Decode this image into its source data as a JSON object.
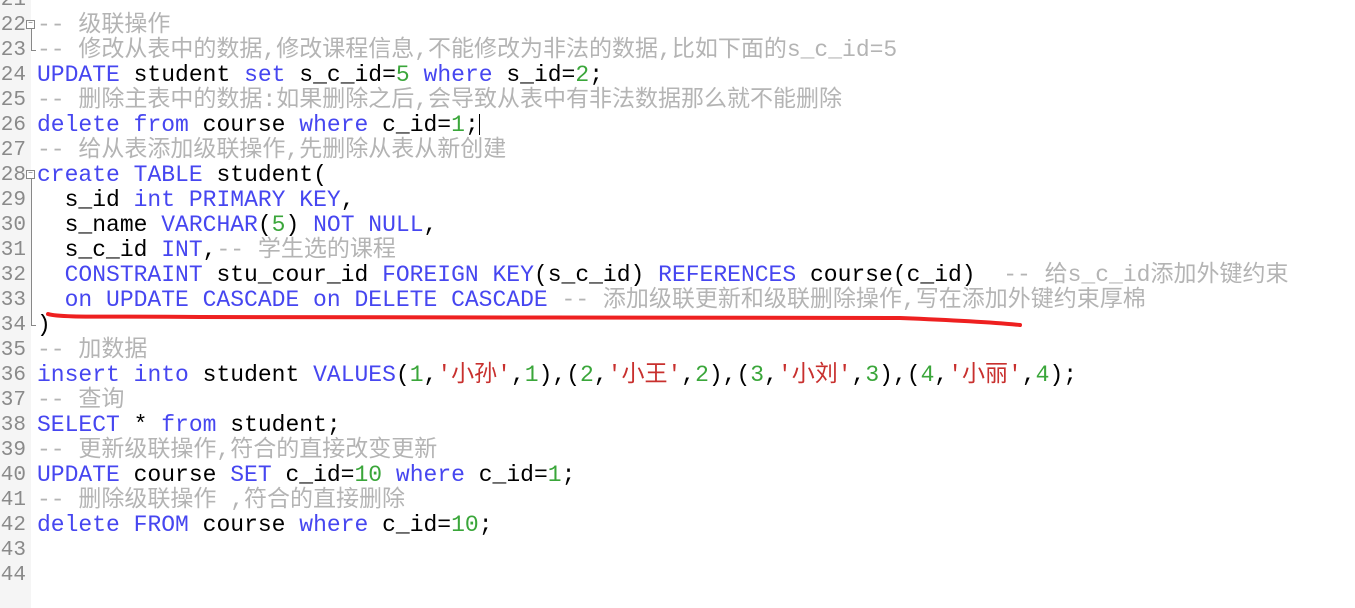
{
  "editor": {
    "colors": {
      "keyword": "#4646f0",
      "identifier": "#000000",
      "number": "#3aa63a",
      "string": "#c8302e",
      "comment": "#b4b4b4",
      "annotation": "#ee2020"
    },
    "lines": [
      {
        "n": "21",
        "t": []
      },
      {
        "n": "22",
        "fold": "open",
        "t": [
          [
            "cm",
            "-- 级联操作"
          ]
        ]
      },
      {
        "n": "23",
        "fold": "end",
        "t": [
          [
            "cm",
            "-- 修改从表中的数据,修改课程信息,不能修改为非法的数据,比如下面的s_c_id=5"
          ]
        ]
      },
      {
        "n": "24",
        "t": [
          [
            "kw",
            "UPDATE"
          ],
          [
            "id",
            " student "
          ],
          [
            "kw",
            "set"
          ],
          [
            "id",
            " s_c_id="
          ],
          [
            "num",
            "5"
          ],
          [
            "id",
            " "
          ],
          [
            "kw",
            "where"
          ],
          [
            "id",
            " s_id="
          ],
          [
            "num",
            "2"
          ],
          [
            "id",
            ";"
          ]
        ]
      },
      {
        "n": "25",
        "t": [
          [
            "cm",
            "-- 删除主表中的数据:如果删除之后,会导致从表中有非法数据那么就不能删除"
          ]
        ]
      },
      {
        "n": "26",
        "caret": true,
        "t": [
          [
            "kw",
            "delete"
          ],
          [
            "id",
            " "
          ],
          [
            "kw",
            "from"
          ],
          [
            "id",
            " course "
          ],
          [
            "kw",
            "where"
          ],
          [
            "id",
            " c_id="
          ],
          [
            "num",
            "1"
          ],
          [
            "id",
            ";"
          ]
        ]
      },
      {
        "n": "27",
        "t": [
          [
            "cm",
            "-- 给从表添加级联操作,先删除从表从新创建"
          ]
        ]
      },
      {
        "n": "28",
        "fold": "open",
        "t": [
          [
            "kw",
            "create"
          ],
          [
            "id",
            " "
          ],
          [
            "kw",
            "TABLE"
          ],
          [
            "id",
            " student("
          ]
        ]
      },
      {
        "n": "29",
        "t": [
          [
            "id",
            "  s_id "
          ],
          [
            "kw",
            "int"
          ],
          [
            "id",
            " "
          ],
          [
            "kw",
            "PRIMARY KEY"
          ],
          [
            "id",
            ","
          ]
        ]
      },
      {
        "n": "30",
        "t": [
          [
            "id",
            "  s_name "
          ],
          [
            "kw",
            "VARCHAR"
          ],
          [
            "id",
            "("
          ],
          [
            "num",
            "5"
          ],
          [
            "id",
            ") "
          ],
          [
            "kw",
            "NOT NULL"
          ],
          [
            "id",
            ","
          ]
        ]
      },
      {
        "n": "31",
        "t": [
          [
            "id",
            "  s_c_id "
          ],
          [
            "kw",
            "INT"
          ],
          [
            "id",
            ","
          ],
          [
            "cm",
            "-- 学生选的课程"
          ]
        ]
      },
      {
        "n": "32",
        "t": [
          [
            "id",
            "  "
          ],
          [
            "kw",
            "CONSTRAINT"
          ],
          [
            "id",
            " stu_cour_id "
          ],
          [
            "kw",
            "FOREIGN KEY"
          ],
          [
            "id",
            "(s_c_id) "
          ],
          [
            "kw",
            "REFERENCES"
          ],
          [
            "id",
            " course(c_id)  "
          ],
          [
            "cm",
            "-- 给s_c_id添加外键约束"
          ]
        ]
      },
      {
        "n": "33",
        "t": [
          [
            "id",
            "  "
          ],
          [
            "kw",
            "on UPDATE CASCADE on DELETE CASCADE"
          ],
          [
            "id",
            " "
          ],
          [
            "cm",
            "-- 添加级联更新和级联删除操作,写在添加外键约束厚棉"
          ]
        ]
      },
      {
        "n": "34",
        "fold": "end",
        "t": [
          [
            "id",
            ")"
          ]
        ]
      },
      {
        "n": "35",
        "t": [
          [
            "cm",
            "-- 加数据"
          ]
        ]
      },
      {
        "n": "36",
        "t": [
          [
            "kw",
            "insert"
          ],
          [
            "id",
            " "
          ],
          [
            "kw",
            "into"
          ],
          [
            "id",
            " student "
          ],
          [
            "kw",
            "VALUES"
          ],
          [
            "id",
            "("
          ],
          [
            "num",
            "1"
          ],
          [
            "id",
            ","
          ],
          [
            "str",
            "'小孙'"
          ],
          [
            "id",
            ","
          ],
          [
            "num",
            "1"
          ],
          [
            "id",
            "),("
          ],
          [
            "num",
            "2"
          ],
          [
            "id",
            ","
          ],
          [
            "str",
            "'小王'"
          ],
          [
            "id",
            ","
          ],
          [
            "num",
            "2"
          ],
          [
            "id",
            "),("
          ],
          [
            "num",
            "3"
          ],
          [
            "id",
            ","
          ],
          [
            "str",
            "'小刘'"
          ],
          [
            "id",
            ","
          ],
          [
            "num",
            "3"
          ],
          [
            "id",
            "),("
          ],
          [
            "num",
            "4"
          ],
          [
            "id",
            ","
          ],
          [
            "str",
            "'小丽'"
          ],
          [
            "id",
            ","
          ],
          [
            "num",
            "4"
          ],
          [
            "id",
            ");"
          ]
        ]
      },
      {
        "n": "37",
        "t": [
          [
            "cm",
            "-- 查询"
          ]
        ]
      },
      {
        "n": "38",
        "t": [
          [
            "kw",
            "SELECT"
          ],
          [
            "id",
            " * "
          ],
          [
            "kw",
            "from"
          ],
          [
            "id",
            " student;"
          ]
        ]
      },
      {
        "n": "39",
        "t": [
          [
            "cm",
            "-- 更新级联操作,符合的直接改变更新"
          ]
        ]
      },
      {
        "n": "40",
        "t": [
          [
            "kw",
            "UPDATE"
          ],
          [
            "id",
            " course "
          ],
          [
            "kw",
            "SET"
          ],
          [
            "id",
            " c_id="
          ],
          [
            "num",
            "10"
          ],
          [
            "id",
            " "
          ],
          [
            "kw",
            "where"
          ],
          [
            "id",
            " c_id="
          ],
          [
            "num",
            "1"
          ],
          [
            "id",
            ";"
          ]
        ]
      },
      {
        "n": "41",
        "t": [
          [
            "cm",
            "-- 删除级联操作 ,符合的直接删除"
          ]
        ]
      },
      {
        "n": "42",
        "t": [
          [
            "kw",
            "delete"
          ],
          [
            "id",
            " "
          ],
          [
            "kw",
            "FROM"
          ],
          [
            "id",
            " course "
          ],
          [
            "kw",
            "where"
          ],
          [
            "id",
            " c_id="
          ],
          [
            "num",
            "10"
          ],
          [
            "id",
            ";"
          ]
        ]
      },
      {
        "n": "43",
        "t": []
      },
      {
        "n": "44",
        "t": []
      }
    ]
  }
}
